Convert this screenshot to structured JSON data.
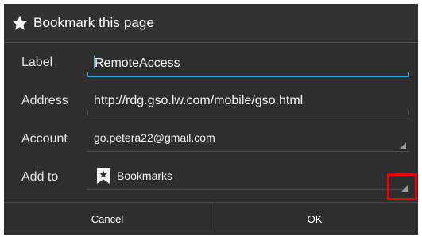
{
  "dialog": {
    "title": "Bookmark this page",
    "title_icon": "star-icon"
  },
  "fields": {
    "label": {
      "caption": "Label",
      "value": "RemoteAccess"
    },
    "address": {
      "caption": "Address",
      "value": "http://rdg.gso.lw.com/mobile/gso.html"
    },
    "account": {
      "caption": "Account",
      "value": "go.petera22@gmail.com"
    },
    "add_to": {
      "caption": "Add to",
      "value": "Bookmarks",
      "icon": "bookmark-star-icon"
    }
  },
  "buttons": {
    "cancel": "Cancel",
    "ok": "OK"
  },
  "colors": {
    "dialog_bg": "#2e2e2e",
    "accent": "#2aa7d6",
    "highlight": "#e8000b"
  }
}
